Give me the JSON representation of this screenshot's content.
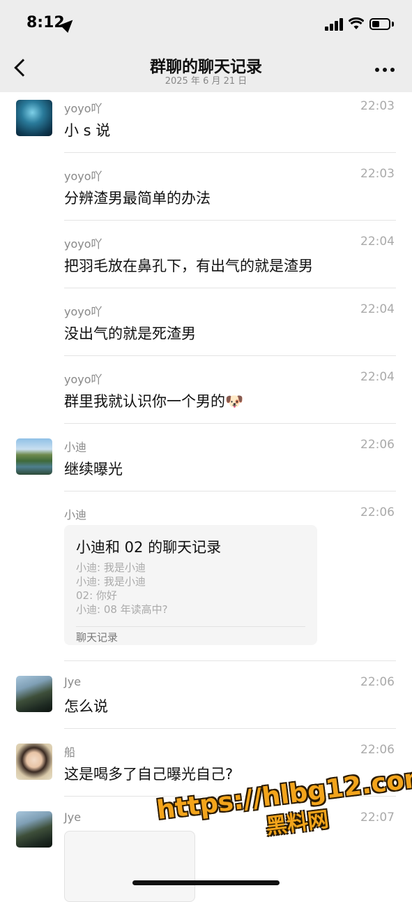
{
  "status": {
    "time": "8:12"
  },
  "nav": {
    "title": "群聊的聊天记录",
    "subtitle": "2025 年 6 月 21 日"
  },
  "messages": [
    {
      "sender": "yoyo吖",
      "time": "22:03",
      "text": "小 s 说",
      "avatar": "underwater-photo"
    },
    {
      "sender": "yoyo吖",
      "time": "22:03",
      "text": "分辨渣男最简单的办法"
    },
    {
      "sender": "yoyo吖",
      "time": "22:04",
      "text": "把羽毛放在鼻孔下，有出气的就是渣男"
    },
    {
      "sender": "yoyo吖",
      "time": "22:04",
      "text": "没出气的就是死渣男"
    },
    {
      "sender": "yoyo吖",
      "time": "22:04",
      "text": "群里我就认识你一个男的",
      "emoji": "🐶"
    },
    {
      "sender": "小迪",
      "time": "22:06",
      "text": "继续曝光",
      "avatar": "lake-landscape"
    },
    {
      "sender": "小迪",
      "time": "22:06"
    },
    {
      "sender": "Jye",
      "time": "22:06",
      "text": "怎么说",
      "avatar": "rocky-scene"
    },
    {
      "sender": "船",
      "time": "22:06",
      "text": "这是喝多了自己曝光自己?",
      "avatar": "portrait"
    },
    {
      "sender": "Jye",
      "time": "22:07",
      "avatar": "rocky-scene"
    }
  ],
  "forward_card": {
    "title": "小迪和 02 的聊天记录",
    "lines": [
      "小迪: 我是小迪",
      "小迪: 我是小迪",
      "02: 你好",
      "小迪: 08 年读高中?"
    ],
    "footer": "聊天记录"
  },
  "watermark": {
    "url": "https://hlbg12.com",
    "name": "黑料网"
  }
}
